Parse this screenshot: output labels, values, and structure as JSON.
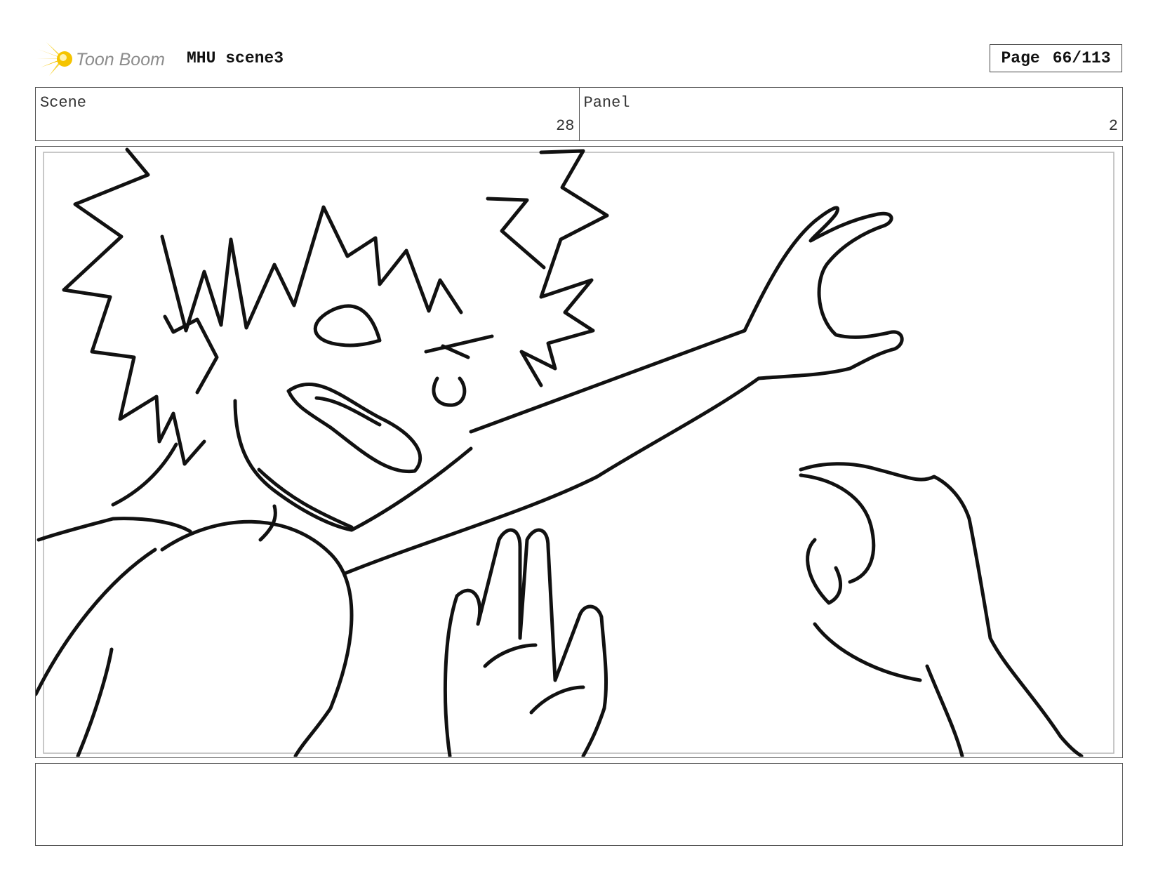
{
  "header": {
    "brand": "Toon Boom",
    "project_title": "MHU scene3",
    "page_label": "Page",
    "page_number": "66/113"
  },
  "info": {
    "scene_label": "Scene",
    "scene_value": "28",
    "panel_label": "Panel",
    "panel_value": "2"
  },
  "caption": {
    "text": ""
  },
  "colors": {
    "logo_yellow": "#f5c400",
    "logo_text": "#8c8c8c",
    "line_art": "#111111"
  }
}
